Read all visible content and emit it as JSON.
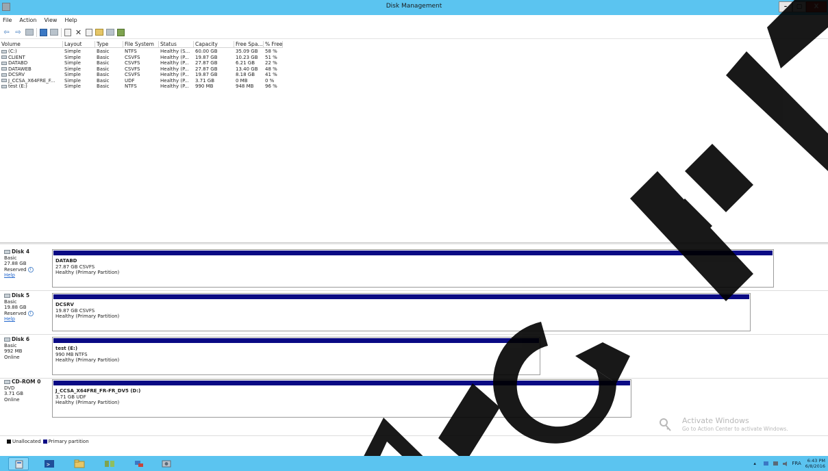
{
  "window": {
    "title": "Disk Management",
    "controls": [
      "–",
      "▢",
      "X"
    ]
  },
  "menu": [
    "File",
    "Action",
    "View",
    "Help"
  ],
  "columns": [
    "Volume",
    "Layout",
    "Type",
    "File System",
    "Status",
    "Capacity",
    "Free Spa...",
    "% Free"
  ],
  "volumes": [
    {
      "volume": "(C:)",
      "layout": "Simple",
      "type": "Basic",
      "fs": "NTFS",
      "status": "Healthy (S...",
      "capacity": "60.00 GB",
      "free": "35.09 GB",
      "pct": "58 %"
    },
    {
      "volume": "CLIENT",
      "layout": "Simple",
      "type": "Basic",
      "fs": "CSVFS",
      "status": "Healthy (P...",
      "capacity": "19.87 GB",
      "free": "10.23 GB",
      "pct": "51 %"
    },
    {
      "volume": "DATABD",
      "layout": "Simple",
      "type": "Basic",
      "fs": "CSVFS",
      "status": "Healthy (P...",
      "capacity": "27.87 GB",
      "free": "6.21 GB",
      "pct": "22 %"
    },
    {
      "volume": "DATAWEB",
      "layout": "Simple",
      "type": "Basic",
      "fs": "CSVFS",
      "status": "Healthy (P...",
      "capacity": "27.87 GB",
      "free": "13.40 GB",
      "pct": "48 %"
    },
    {
      "volume": "DCSRV",
      "layout": "Simple",
      "type": "Basic",
      "fs": "CSVFS",
      "status": "Healthy (P...",
      "capacity": "19.87 GB",
      "free": "8.18 GB",
      "pct": "41 %"
    },
    {
      "volume": "J_CCSA_X64FRE_F...",
      "layout": "Simple",
      "type": "Basic",
      "fs": "UDF",
      "status": "Healthy (P...",
      "capacity": "3.71 GB",
      "free": "0 MB",
      "pct": "0 %"
    },
    {
      "volume": "test (E:)",
      "layout": "Simple",
      "type": "Basic",
      "fs": "NTFS",
      "status": "Healthy (P...",
      "capacity": "990 MB",
      "free": "948 MB",
      "pct": "96 %"
    }
  ],
  "disks": [
    {
      "name": "Disk 4",
      "kind": "Basic",
      "size": "27.88 GB",
      "state": "Reserved",
      "help": "Help",
      "part_name": "DATABD",
      "part_size": "27.87 GB CSVFS",
      "part_status": "Healthy (Primary Partition)"
    },
    {
      "name": "Disk 5",
      "kind": "Basic",
      "size": "19.88 GB",
      "state": "Reserved",
      "help": "Help",
      "part_name": "DCSRV",
      "part_size": "19.87 GB CSVFS",
      "part_status": "Healthy (Primary Partition)"
    },
    {
      "name": "Disk 6",
      "kind": "Basic",
      "size": "992 MB",
      "state": "Online",
      "part_name": "test  (E:)",
      "part_size": "990 MB NTFS",
      "part_status": "Healthy (Primary Partition)"
    },
    {
      "name": "CD-ROM 0",
      "kind": "DVD",
      "size": "3.71 GB",
      "state": "Online",
      "part_name": "J_CCSA_X64FRE_FR-FR_DV5  (D:)",
      "part_size": "3.71 GB UDF",
      "part_status": "Healthy (Primary Partition)"
    }
  ],
  "legend": {
    "unallocated": "Unallocated",
    "primary": "Primary partition"
  },
  "activation": {
    "title": "Activate Windows",
    "subtitle": "Go to Action Center to activate Windows."
  },
  "watermark": "RIGHT",
  "tray": {
    "lang": "FRA",
    "time": "6:43 PM",
    "date": "6/8/2016"
  },
  "colors": {
    "titlebar": "#5bc4f0",
    "partition_bar": "#0a0a84",
    "close": "#c7443a"
  }
}
